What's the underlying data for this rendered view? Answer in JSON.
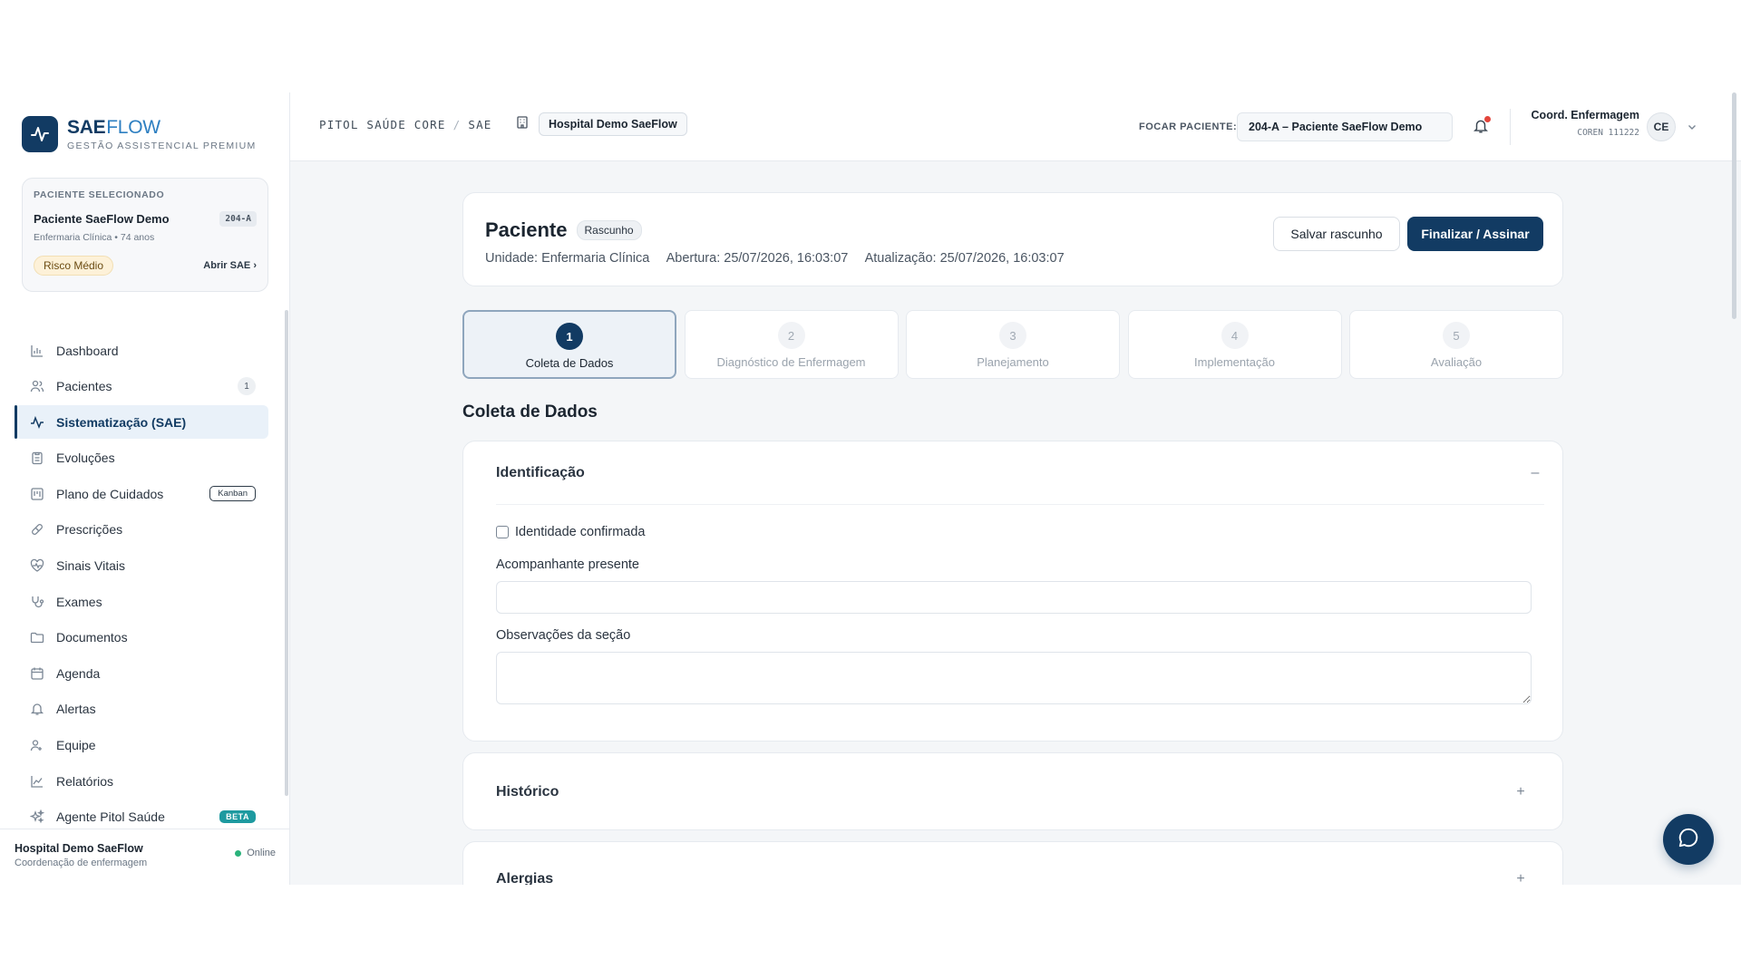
{
  "brand": {
    "name": "SAE",
    "name_accent": "FLOW",
    "tagline": "GESTÃO ASSISTENCIAL PREMIUM"
  },
  "patient_card": {
    "label": "PACIENTE SELECIONADO",
    "name": "Paciente SaeFlow Demo",
    "bed": "204-A",
    "meta": "Enfermaria Clínica • 74 anos",
    "risk": "Risco Médio",
    "open_link": "Abrir SAE"
  },
  "nav": {
    "items": [
      {
        "label": "Dashboard",
        "icon": "bar-chart-icon"
      },
      {
        "label": "Pacientes",
        "icon": "users-icon",
        "badge": "1"
      },
      {
        "label": "Sistematização (SAE)",
        "icon": "activity-icon",
        "active": true
      },
      {
        "label": "Evoluções",
        "icon": "clipboard-icon"
      },
      {
        "label": "Plano de Cuidados",
        "icon": "kanban-icon",
        "badge": "Kanban"
      },
      {
        "label": "Prescrições",
        "icon": "pill-icon"
      },
      {
        "label": "Sinais Vitais",
        "icon": "heart-pulse-icon"
      },
      {
        "label": "Exames",
        "icon": "stethoscope-icon"
      },
      {
        "label": "Documentos",
        "icon": "folder-icon"
      },
      {
        "label": "Agenda",
        "icon": "calendar-icon"
      },
      {
        "label": "Alertas",
        "icon": "bell-icon"
      },
      {
        "label": "Equipe",
        "icon": "team-icon"
      },
      {
        "label": "Relatórios",
        "icon": "line-chart-icon"
      },
      {
        "label": "Agente Pitol Saúde",
        "icon": "sparkles-icon",
        "badge": "BETA"
      }
    ]
  },
  "sidebar_footer": {
    "hospital": "Hospital Demo SaeFlow",
    "role": "Coordenação de enfermagem",
    "status": "Online"
  },
  "header": {
    "breadcrumb": [
      "PITOL SAÚDE CORE",
      "SAE"
    ],
    "hospital": "Hospital Demo SaeFlow",
    "focus_label": "FOCAR PACIENTE:",
    "focus_value": "204-A – Paciente SaeFlow Demo",
    "user_name": "Coord. Enfermagem",
    "user_coren": "COREN 111222",
    "avatar": "CE"
  },
  "record": {
    "title": "Paciente",
    "status": "Rascunho",
    "unit": "Unidade: Enfermaria Clínica",
    "opened": "Abertura: 25/07/2026, 16:03:07",
    "updated": "Atualização: 25/07/2026, 16:03:07",
    "save_label": "Salvar rascunho",
    "finalize_label": "Finalizar / Assinar"
  },
  "steps": [
    {
      "num": "1",
      "label": "Coleta de Dados",
      "active": true
    },
    {
      "num": "2",
      "label": "Diagnóstico de Enfermagem"
    },
    {
      "num": "3",
      "label": "Planejamento"
    },
    {
      "num": "4",
      "label": "Implementação"
    },
    {
      "num": "5",
      "label": "Avaliação"
    }
  ],
  "section_title": "Coleta de Dados",
  "sections": {
    "identificacao": {
      "title": "Identificação",
      "toggle": "–",
      "checkbox_label": "Identidade confirmada",
      "companion_label": "Acompanhante presente",
      "companion_value": "",
      "notes_label": "Observações da seção",
      "notes_value": ""
    },
    "historico": {
      "title": "Histórico",
      "toggle": "+"
    },
    "alergias": {
      "title": "Alergias",
      "toggle": "+"
    }
  },
  "colors": {
    "primary": "#123b63",
    "accent": "#2d7fc1",
    "online": "#2ab27b",
    "alert": "#e3453b",
    "beta": "#1e9aa0"
  }
}
